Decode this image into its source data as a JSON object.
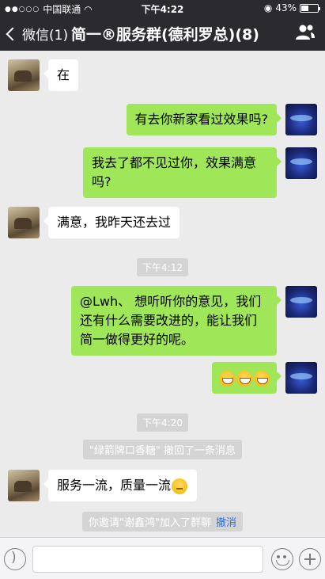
{
  "status": {
    "carrier": "中国联通",
    "time": "下午4:22",
    "battery": "43%"
  },
  "nav": {
    "back_label": "微信(1)",
    "title": "简一®服务群(德利罗总)(8)"
  },
  "messages": [
    {
      "side": "left",
      "text": "在"
    },
    {
      "side": "right",
      "text": "有去你新家看过效果吗?"
    },
    {
      "side": "right",
      "text": "我去了都不见过你，效果满意吗?"
    },
    {
      "side": "left",
      "text": "满意，我昨天还去过"
    },
    {
      "side": "time",
      "text": "下午4:12"
    },
    {
      "side": "right",
      "text": "@Lwh、 想听听你的意见，我们还有什么需要改进的，能让我们简一做得更好的呢。"
    },
    {
      "side": "right",
      "emoji": [
        "grin",
        "grin",
        "grin"
      ]
    },
    {
      "side": "time",
      "text": "下午4:20"
    },
    {
      "side": "system",
      "text": "\"绿箭牌口香糖\" 撤回了一条消息"
    },
    {
      "side": "left",
      "text": "服务一流，质量一流",
      "emoji": [
        "think"
      ]
    },
    {
      "side": "system",
      "text": "你邀请\"谢鑫鸿\"加入了群聊",
      "link": "撤消"
    }
  ],
  "colors": {
    "header_bg": "#2b2b2f",
    "chat_bg": "#ebebeb",
    "bubble_self": "#9fe658",
    "bubble_other": "#ffffff",
    "link": "#2e6fd6"
  }
}
